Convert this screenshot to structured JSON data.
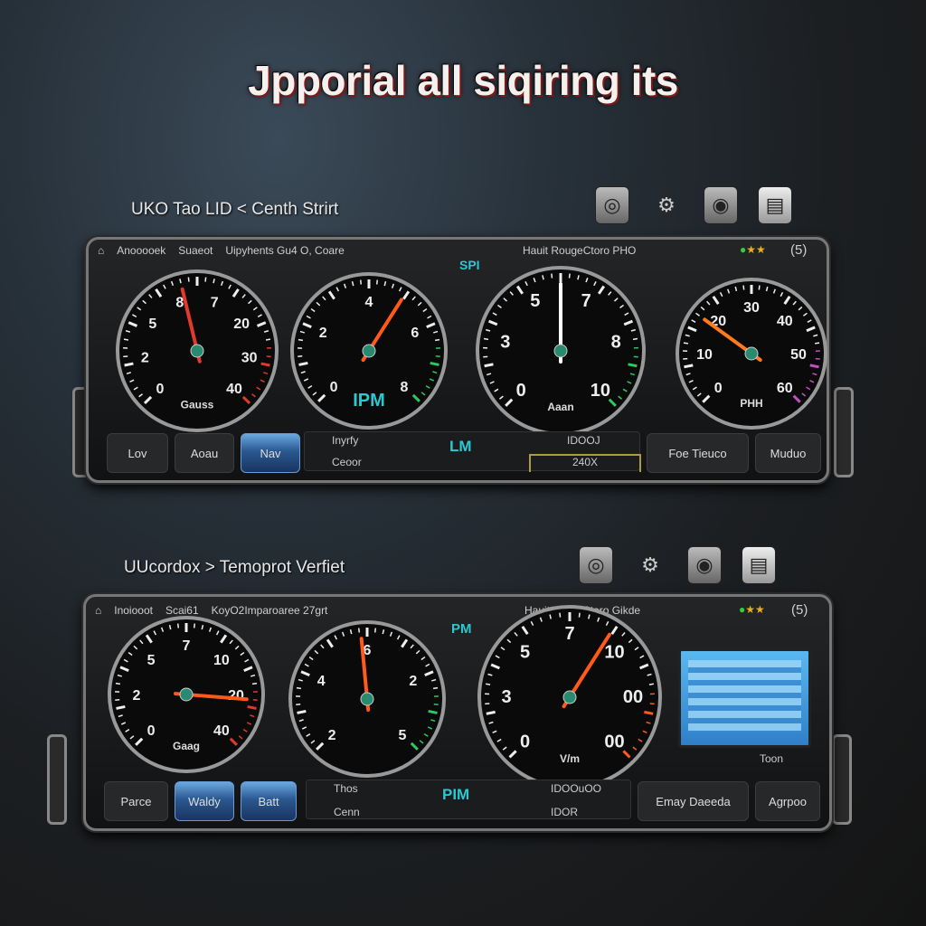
{
  "title": "Jpporial all siqiring its",
  "sections": [
    {
      "label": "UKO Tao LID < Centh Strirt",
      "header": {
        "left": [
          "Anooooek",
          "Suaeot",
          "Uipyhents Gu4 O, Coare"
        ],
        "right": "Hauit RougeCtoro PHO",
        "rating": "(5)"
      },
      "top_badge": "SPI",
      "gauges": [
        {
          "labels": [
            "0",
            "2",
            "5",
            "8",
            "7",
            "20",
            "30",
            "40"
          ],
          "caption": "Gauss",
          "needle": 0.45,
          "accent": "#e03a2a",
          "scale": "#e03a2a"
        },
        {
          "labels": [
            "0",
            "2",
            "4",
            "6",
            "8"
          ],
          "caption": "IPM",
          "needle": 0.62,
          "accent": "#ff5a1a",
          "scale": "#2cc860"
        },
        {
          "labels": [
            "0",
            "3",
            "5",
            "7",
            "8",
            "10"
          ],
          "caption": "Aaan",
          "needle": 0.5,
          "accent": "#ffffff",
          "scale": "#2cc860"
        },
        {
          "labels": [
            "0",
            "10",
            "20",
            "30",
            "40",
            "50",
            "60"
          ],
          "caption": "PHH",
          "needle": 0.3,
          "accent": "#ff7a1a",
          "scale": "#c050c0"
        }
      ],
      "buttons_left": [
        "Lov",
        "Aoau",
        "Nav"
      ],
      "center": {
        "top": "Inyrfy",
        "bottom": "Ceoor",
        "mid": "LM",
        "right": "IDOOJ",
        "box": "240X"
      },
      "buttons_right": [
        "Foe Tieuco",
        "Muduo"
      ]
    },
    {
      "label": "UUcordox > Temoprot Verfiet",
      "header": {
        "left": [
          "Inoiooot",
          "Scai61",
          "KoyO2Imparoaree 27grt"
        ],
        "right": "Hauit DoareCtoro Gikde",
        "rating": "(5)"
      },
      "top_badge": "PM",
      "gauges": [
        {
          "labels": [
            "0",
            "2",
            "5",
            "7",
            "10",
            "20",
            "40"
          ],
          "caption": "Gaag",
          "needle": 0.85,
          "accent": "#ff5a1a",
          "scale": "#e03a2a"
        },
        {
          "labels": [
            "2",
            "4",
            "6",
            "2",
            "5"
          ],
          "caption": "",
          "needle": 0.48,
          "accent": "#ff5a1a",
          "scale": "#2cc860"
        },
        {
          "labels": [
            "0",
            "3",
            "5",
            "7",
            "10",
            "00",
            "00"
          ],
          "caption": "V/m",
          "needle": 0.62,
          "accent": "#ff5a1a",
          "scale": "#ff5a1a"
        }
      ],
      "screen_label": "Toon",
      "buttons_left": [
        "Parce",
        "Waldy",
        "Batt"
      ],
      "center": {
        "top": "Thos",
        "bottom": "Cenn",
        "mid": "PIM",
        "right": "IDOOuOO",
        "box": "IDOR"
      },
      "buttons_right": [
        "Emay Daeeda",
        "Agrpoo"
      ]
    }
  ],
  "icons": [
    "gauge-icon",
    "engine-icon",
    "tire-icon",
    "document-icon"
  ],
  "colors": {
    "accent_teal": "#2cc8d0",
    "rating_star": "#e8b020",
    "rating_dot": "#30d040"
  }
}
